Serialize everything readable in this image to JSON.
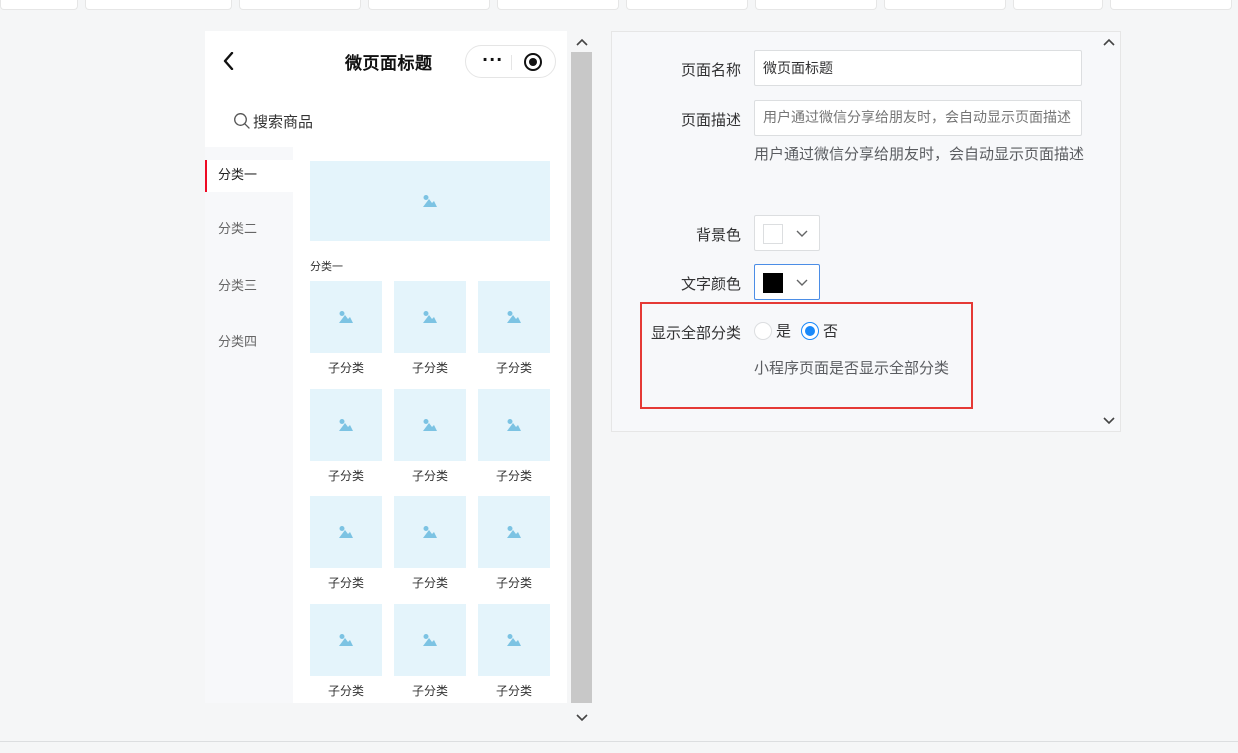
{
  "preview": {
    "nav_title": "微页面标题",
    "search_placeholder": "搜索商品",
    "categories": [
      "分类一",
      "分类二",
      "分类三",
      "分类四"
    ],
    "active_category": "分类一",
    "section_title": "分类一",
    "sub_items": [
      "子分类",
      "子分类",
      "子分类",
      "子分类",
      "子分类",
      "子分类",
      "子分类",
      "子分类",
      "子分类",
      "子分类",
      "子分类",
      "子分类"
    ],
    "icons": {
      "back": "chevron-left-icon",
      "more": "more-dots-icon",
      "capsule_close": "record-target-icon",
      "search": "search-icon",
      "image_placeholder": "image-placeholder-icon"
    }
  },
  "form": {
    "page_name_label": "页面名称",
    "page_name_value": "微页面标题",
    "page_desc_label": "页面描述",
    "page_desc_placeholder": "用户通过微信分享给朋友时，会自动显示页面描述",
    "page_desc_help": "用户通过微信分享给朋友时，会自动显示页面描述",
    "bg_color_label": "背景色",
    "bg_color_value": "#ffffff",
    "text_color_label": "文字颜色",
    "text_color_value": "#000000",
    "show_all_label": "显示全部分类",
    "radio_yes": "是",
    "radio_no": "否",
    "radio_selected": "否",
    "show_all_help": "小程序页面是否显示全部分类"
  },
  "colors": {
    "accent": "#1989fa",
    "active_category_marker": "#ee0a24",
    "highlight_box": "#e53935",
    "placeholder_bg": "#e4f4fb"
  }
}
